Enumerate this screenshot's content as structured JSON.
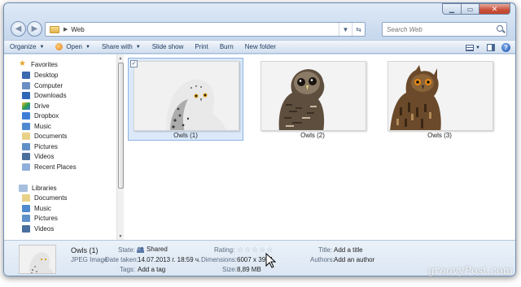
{
  "address": {
    "path": "Web"
  },
  "search": {
    "placeholder": "Search Web"
  },
  "toolbar": {
    "organize": "Organize",
    "open": "Open",
    "share_with": "Share with",
    "slide_show": "Slide show",
    "print": "Print",
    "burn": "Burn",
    "new_folder": "New folder"
  },
  "sidebar": {
    "favorites_header": "Favorites",
    "favorites": [
      "Desktop",
      "Computer",
      "Downloads",
      "Drive",
      "Dropbox",
      "Music",
      "Documents",
      "Pictures",
      "Videos",
      "Recent Places"
    ],
    "libraries_header": "Libraries",
    "libraries": [
      "Documents",
      "Music",
      "Pictures",
      "Videos"
    ]
  },
  "files": [
    {
      "name": "Owls (1)",
      "selected": true
    },
    {
      "name": "Owls (2)",
      "selected": false
    },
    {
      "name": "Owls (3)",
      "selected": false
    }
  ],
  "details": {
    "name": "Owls (1)",
    "type": "JPEG Image",
    "state_label": "State:",
    "state_value": "Shared",
    "date_label": "Date taken:",
    "date_value": "14.07.2013 г. 18:59 ч.",
    "tags_label": "Tags:",
    "tags_value": "Add a tag",
    "rating_label": "Rating:",
    "rating_stars": 0,
    "dimensions_label": "Dimensions:",
    "dimensions_value": "6007 x 3994",
    "size_label": "Size:",
    "size_value": "8,89 MB",
    "title_label": "Title:",
    "title_value": "Add a title",
    "authors_label": "Authors:",
    "authors_value": "Add an author"
  },
  "watermark": "groovyPost.com"
}
